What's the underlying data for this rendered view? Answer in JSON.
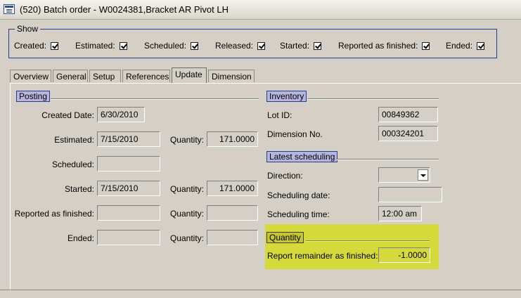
{
  "window": {
    "title": "(520) Batch order - W0024381,Bracket AR Pivot LH",
    "icon": "form-icon"
  },
  "show": {
    "legend": "Show",
    "items": [
      {
        "label": "Created:",
        "checked": true
      },
      {
        "label": "Estimated:",
        "checked": true
      },
      {
        "label": "Scheduled:",
        "checked": true
      },
      {
        "label": "Released:",
        "checked": true
      },
      {
        "label": "Started:",
        "checked": true
      },
      {
        "label": "Reported as finished:",
        "checked": true
      },
      {
        "label": "Ended:",
        "checked": true
      }
    ]
  },
  "tabs": [
    {
      "label": "Overview"
    },
    {
      "label": "General"
    },
    {
      "label": "Setup"
    },
    {
      "label": "References"
    },
    {
      "label": "Update",
      "active": true
    },
    {
      "label": "Dimension"
    }
  ],
  "posting": {
    "header": "Posting",
    "created_date": {
      "label": "Created Date:",
      "value": "6/30/2010"
    },
    "estimated": {
      "label": "Estimated:",
      "value": "7/15/2010",
      "qty_label": "Quantity:",
      "qty_value": "171.0000"
    },
    "scheduled": {
      "label": "Scheduled:",
      "value": ""
    },
    "started": {
      "label": "Started:",
      "value": "7/15/2010",
      "qty_label": "Quantity:",
      "qty_value": "171.0000"
    },
    "reported": {
      "label": "Reported as finished:",
      "value": "",
      "qty_label": "Quantity:",
      "qty_value": ""
    },
    "ended": {
      "label": "Ended:",
      "value": "",
      "qty_label": "Quantity:",
      "qty_value": ""
    }
  },
  "inventory": {
    "header": "Inventory",
    "lot_id": {
      "label": "Lot ID:",
      "value": "00849362"
    },
    "dimension_no": {
      "label": "Dimension No.",
      "value": "000324201"
    }
  },
  "latest_scheduling": {
    "header": "Latest scheduling",
    "direction": {
      "label": "Direction:",
      "value": ""
    },
    "date": {
      "label": "Scheduling date:",
      "value": ""
    },
    "time": {
      "label": "Scheduling time:",
      "value": "12:00 am"
    }
  },
  "quantity": {
    "header": "Quantity",
    "highlight_color": "#d6d93c",
    "report_remainder": {
      "label": "Report remainder as finished:",
      "value": "-1.0000"
    }
  }
}
